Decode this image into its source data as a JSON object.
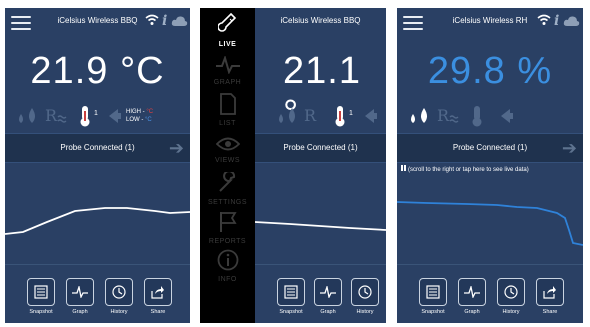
{
  "panels": [
    {
      "title": "iCelsius Wireless BBQ",
      "reading": "21.9 °C",
      "probe_count": "1",
      "high_label": "HIGH",
      "high_unit": "°C",
      "low_label": "LOW",
      "low_unit": "°C",
      "status": "Probe Connected (1)"
    },
    {
      "title": "iCelsius Wireless BBQ",
      "reading": "21.1 °",
      "probe_count": "1",
      "status": "Probe Connected (1)"
    },
    {
      "title": "iCelsius Wireless RH",
      "reading": "29.8 %",
      "status": "Probe Connected (1)",
      "scroll_hint": "(scroll to the right or tap here to see live data)"
    }
  ],
  "drawer": {
    "items": [
      {
        "label": "LIVE",
        "icon": "thermometer-icon",
        "active": true
      },
      {
        "label": "GRAPH",
        "icon": "graph-icon",
        "active": false
      },
      {
        "label": "LIST",
        "icon": "list-icon",
        "active": false
      },
      {
        "label": "VIEWS",
        "icon": "eye-icon",
        "active": false
      },
      {
        "label": "SETTINGS",
        "icon": "wrench-icon",
        "active": false
      },
      {
        "label": "REPORTS",
        "icon": "flag-icon",
        "active": false
      },
      {
        "label": "INFO",
        "icon": "info-icon",
        "active": false
      }
    ]
  },
  "toolbar": {
    "snapshot": "Snapshot",
    "graph": "Graph",
    "history": "History",
    "share": "Share"
  },
  "colors": {
    "screen_bg": "#2a4064",
    "band_bg": "#1f324e",
    "rh_blue": "#3b8fe0",
    "high_red": "#e04040",
    "low_blue": "#4a90e0"
  }
}
